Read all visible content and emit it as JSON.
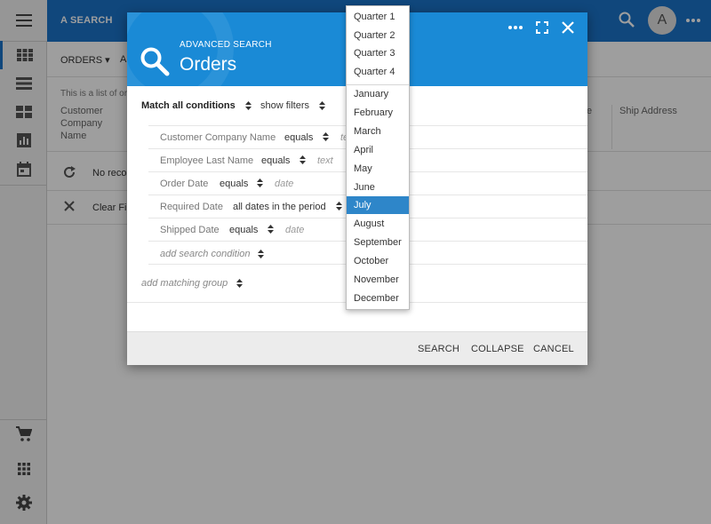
{
  "app": {
    "title": "A SEARCH",
    "avatar_initial": "A"
  },
  "page": {
    "orders_menu": "ORDERS ▾",
    "a_label": "A",
    "description": "This is a list of or",
    "columns": [
      "Customer Company Name",
      "e",
      "Ship Address"
    ],
    "row1_text": "No reco",
    "row2_text": "Clear Fil"
  },
  "dialog": {
    "subtitle": "ADVANCED SEARCH",
    "title": "Orders",
    "match_label": "Match all conditions",
    "show_filters": "show filters",
    "conditions": [
      {
        "field": "Customer Company Name",
        "operator": "equals",
        "value": "te"
      },
      {
        "field": "Employee Last Name",
        "operator": "equals",
        "value": "text"
      },
      {
        "field": "Order Date",
        "operator": "equals",
        "value": "date"
      },
      {
        "field": "Required Date",
        "operator": "all dates in the period",
        "value": ""
      },
      {
        "field": "Shipped Date",
        "operator": "equals",
        "value": "date"
      }
    ],
    "add_condition": "add search condition",
    "add_group": "add matching group",
    "buttons": {
      "search": "SEARCH",
      "collapse": "COLLAPSE",
      "cancel": "CANCEL"
    }
  },
  "dropdown": {
    "items": [
      "Quarter 1",
      "Quarter 2",
      "Quarter 3",
      "Quarter 4",
      "January",
      "February",
      "March",
      "April",
      "May",
      "June",
      "July",
      "August",
      "September",
      "October",
      "November",
      "December"
    ],
    "selected": "July"
  },
  "colors": {
    "brand_blue": "#1a73c8",
    "header_blue": "#1a8ad6",
    "selected_blue": "#2e86c9"
  }
}
